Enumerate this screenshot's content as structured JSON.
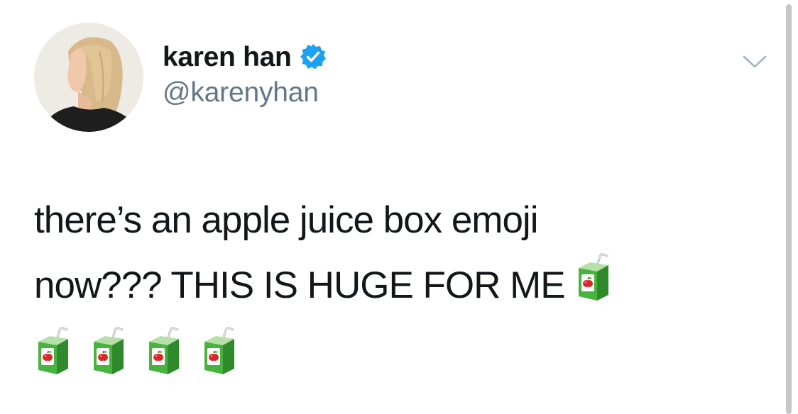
{
  "tweet": {
    "author": {
      "display_name": "karen han",
      "handle": "@karenyhan",
      "verified": true,
      "avatar": "profile-photo"
    },
    "text_lines": [
      "there’s an apple juice box emoji",
      "now??? THIS IS HUGE FOR ME"
    ],
    "emoji": {
      "name": "beverage-box-icon",
      "count_inline": 1,
      "count_row": 4
    },
    "menu_icon": "chevron-down-icon"
  },
  "colors": {
    "text": "#14171a",
    "handle": "#657786",
    "verified_blue": "#1da1f2",
    "juice_green": "#49b33f",
    "apple_red": "#d8262b"
  }
}
